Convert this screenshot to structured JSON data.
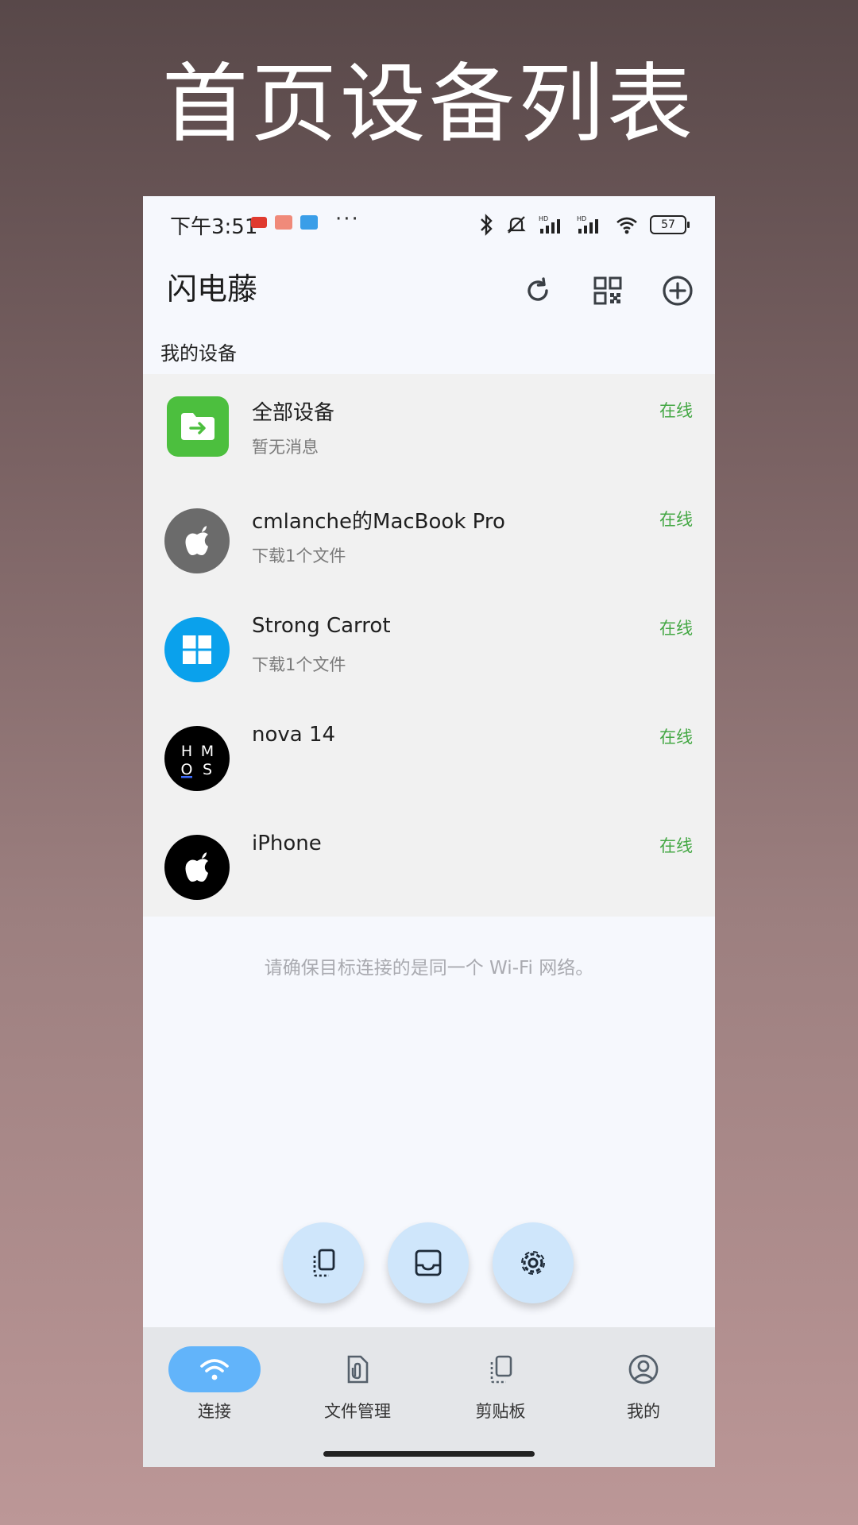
{
  "promo": {
    "title": "首页设备列表"
  },
  "statusbar": {
    "time": "下午3:51",
    "more": "···",
    "battery": "57",
    "hd": "HD"
  },
  "appbar": {
    "title": "闪电藤",
    "icons": [
      "refresh-icon",
      "qr-code-icon",
      "add-circle-icon"
    ]
  },
  "section": {
    "label": "我的设备"
  },
  "devices": [
    {
      "name": "全部设备",
      "sub": "暂无消息",
      "status": "在线",
      "icon": "folder-transfer-icon",
      "color": "#4cbf3e"
    },
    {
      "name": "cmlanche的MacBook Pro",
      "sub": "下载1个文件",
      "status": "在线",
      "icon": "apple-icon",
      "color": "#6b6b6b"
    },
    {
      "name": "Strong Carrot",
      "sub": "下载1个文件",
      "status": "在线",
      "icon": "windows-icon",
      "color": "#0aa1ec"
    },
    {
      "name": "nova 14",
      "sub": "",
      "status": "在线",
      "icon": "hmos-icon",
      "color": "#000000",
      "logo_text": [
        "H",
        "M",
        "O",
        "S"
      ]
    },
    {
      "name": "iPhone",
      "sub": "",
      "status": "在线",
      "icon": "apple-icon",
      "color": "#000000"
    }
  ],
  "hint": "请确保目标连接的是同一个 Wi-Fi 网络。",
  "fabs": [
    "clipboard-copy-icon",
    "inbox-icon",
    "settings-icon"
  ],
  "nav": {
    "items": [
      {
        "label": "连接",
        "icon": "wifi-icon",
        "active": true
      },
      {
        "label": "文件管理",
        "icon": "file-attachment-icon",
        "active": false
      },
      {
        "label": "剪贴板",
        "icon": "clipboard-icon",
        "active": false
      },
      {
        "label": "我的",
        "icon": "profile-icon",
        "active": false
      }
    ]
  },
  "colors": {
    "online": "#45a845",
    "nav_active": "#62b4fa",
    "fab": "#cfe6fb"
  }
}
